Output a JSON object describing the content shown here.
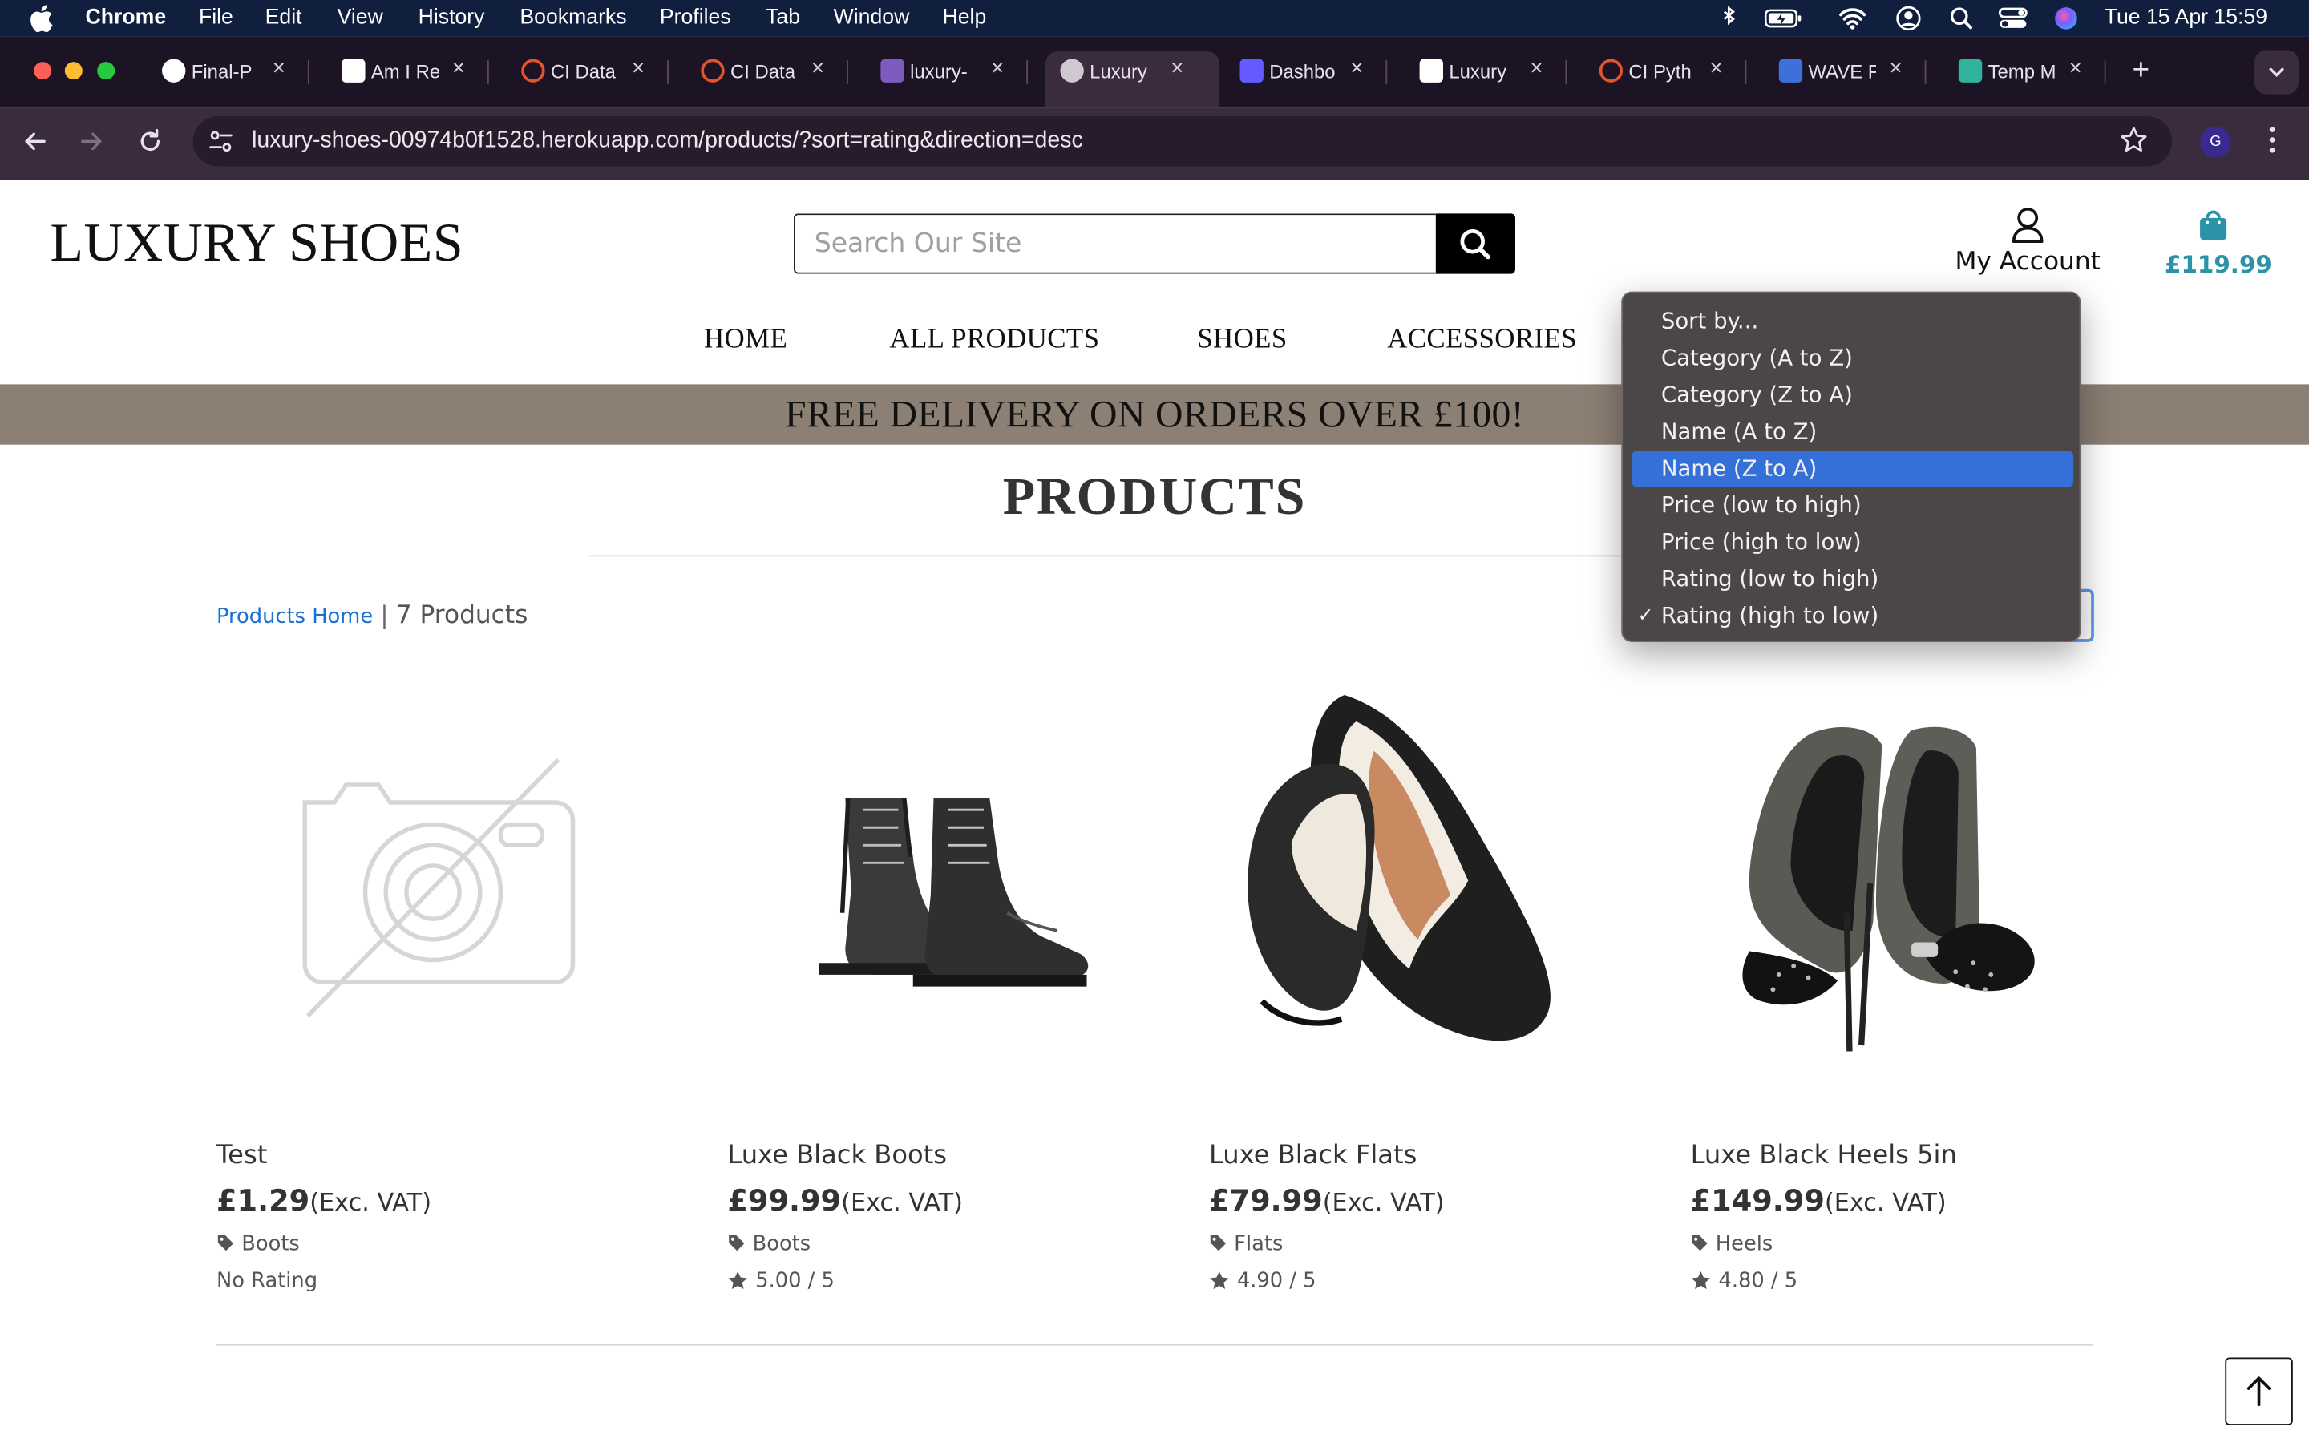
{
  "menubar": {
    "app": "Chrome",
    "items": [
      "File",
      "Edit",
      "View",
      "History",
      "Bookmarks",
      "Profiles",
      "Tab",
      "Window",
      "Help"
    ],
    "datetime": "Tue 15 Apr  15:59"
  },
  "tabs": [
    {
      "label": "Final-P",
      "icon": "github-icon",
      "color": "#ffffff"
    },
    {
      "label": "Am I Re",
      "icon": "ui-icon",
      "color": "#ffffff"
    },
    {
      "label": "CI Data",
      "icon": "ci-icon",
      "color": "#e2552b"
    },
    {
      "label": "CI Data",
      "icon": "ci-icon",
      "color": "#e2552b"
    },
    {
      "label": "luxury-",
      "icon": "heroku-icon",
      "color": "#7d5bbf"
    },
    {
      "label": "Luxury",
      "icon": "globe-icon",
      "color": "#cfc7d2",
      "active": true
    },
    {
      "label": "Dashbo",
      "icon": "stripe-icon",
      "color": "#635bff"
    },
    {
      "label": "Luxury",
      "icon": "heel-icon",
      "color": "#ffffff"
    },
    {
      "label": "CI Pyth",
      "icon": "ci-icon",
      "color": "#e2552b"
    },
    {
      "label": "WAVE F",
      "icon": "wave-icon",
      "color": "#3f6fd8"
    },
    {
      "label": "Temp M",
      "icon": "tempmail-icon",
      "color": "#2fb39a"
    }
  ],
  "toolbar": {
    "url": "luxury-shoes-00974b0f1528.herokuapp.com/products/?sort=rating&direction=desc",
    "profile_initial": "G"
  },
  "site": {
    "brand": "LUXURY SHOES",
    "search_placeholder": "Search Our Site",
    "account_label": "My Account",
    "bag_total": "£119.99",
    "nav": [
      "HOME",
      "ALL PRODUCTS",
      "SHOES",
      "ACCESSORIES"
    ],
    "banner": "FREE DELIVERY ON ORDERS OVER £100!",
    "page_title": "PRODUCTS",
    "breadcrumb_link": "Products Home",
    "breadcrumb_sep": " | ",
    "product_count": "7 Products",
    "accent_color": "#2b93a8",
    "banner_color": "#8c7f74"
  },
  "sort_dropdown": {
    "options": [
      {
        "label": "Sort by..."
      },
      {
        "label": "Category (A to Z)"
      },
      {
        "label": "Category (Z to A)"
      },
      {
        "label": "Name (A to Z)"
      },
      {
        "label": "Name (Z to A)",
        "highlighted": true
      },
      {
        "label": "Price (low to high)"
      },
      {
        "label": "Price (high to low)"
      },
      {
        "label": "Rating (low to high)"
      },
      {
        "label": "Rating (high to low)",
        "selected": true
      }
    ],
    "check_mark": "✓"
  },
  "products": [
    {
      "name": "Test",
      "price": "£1.29",
      "vat": "(Exc. VAT)",
      "category": "Boots",
      "rating": "No Rating",
      "image": "no-image-placeholder"
    },
    {
      "name": "Luxe Black Boots",
      "price": "£99.99",
      "vat": "(Exc. VAT)",
      "category": "Boots",
      "rating": "5.00 / 5",
      "image": "black-boots"
    },
    {
      "name": "Luxe Black Flats",
      "price": "£79.99",
      "vat": "(Exc. VAT)",
      "category": "Flats",
      "rating": "4.90 / 5",
      "image": "black-flats"
    },
    {
      "name": "Luxe Black Heels 5in",
      "price": "£149.99",
      "vat": "(Exc. VAT)",
      "category": "Heels",
      "rating": "4.80 / 5",
      "image": "black-heels"
    }
  ],
  "back_to_top_icon": "arrow-up-icon"
}
